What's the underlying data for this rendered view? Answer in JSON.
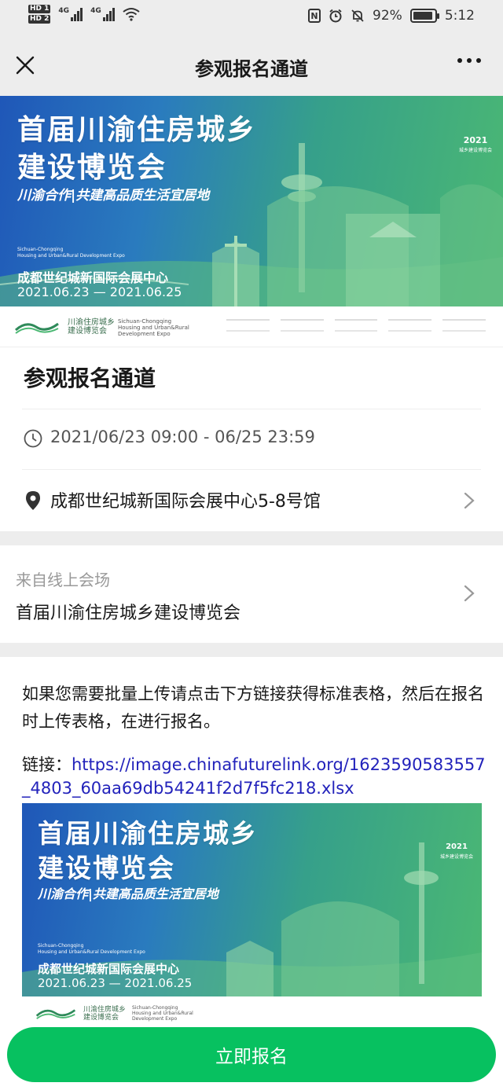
{
  "status_bar": {
    "hd1": "HD 1",
    "hd2": "HD 2",
    "net1": "4G",
    "net2": "4G",
    "battery_percent": "92%",
    "time": "5:12",
    "nfc": "N"
  },
  "nav": {
    "title": "参观报名通道"
  },
  "banner": {
    "title_line1": "首届川渝住房城乡",
    "title_line2": "建设博览会",
    "subtitle": "川渝合作|共建高品质生活宜居地",
    "english_line1": "Sichuan-Chongqing",
    "english_line2": "Housing and Urban&Rural Development Expo",
    "venue": "成都世纪城新国际会展中心",
    "dates": "2021.06.23 — 2021.06.25",
    "year_mark": "2021",
    "year_caption": "城乡建设博览会"
  },
  "logo_strip": {
    "cn_line1": "川渝住房城乡",
    "cn_line2": "建设博览会",
    "en_line1": "Sichuan-Chongqing",
    "en_line2": "Housing and Urban&Rural",
    "en_line3": "Development Expo"
  },
  "event": {
    "title": "参观报名通道",
    "time": "2021/06/23 09:00 - 06/25 23:59",
    "location": "成都世纪城新国际会展中心5-8号馆"
  },
  "source": {
    "label": "来自线上会场",
    "name": "首届川渝住房城乡建设博览会"
  },
  "content": {
    "paragraph": "如果您需要批量上传请点击下方链接获得标准表格，然后在报名时上传表格，在进行报名。",
    "link_prefix": "链接：",
    "link_url": "https://image.chinafuturelink.org/1623590583557_4803_60aa69db54241f2d7f5fc218.xlsx"
  },
  "register_button": "立即报名",
  "colors": {
    "accent_green": "#07c160",
    "link_blue": "#2222bb",
    "banner_blue": "#1f57b8",
    "banner_green": "#4bb873"
  }
}
